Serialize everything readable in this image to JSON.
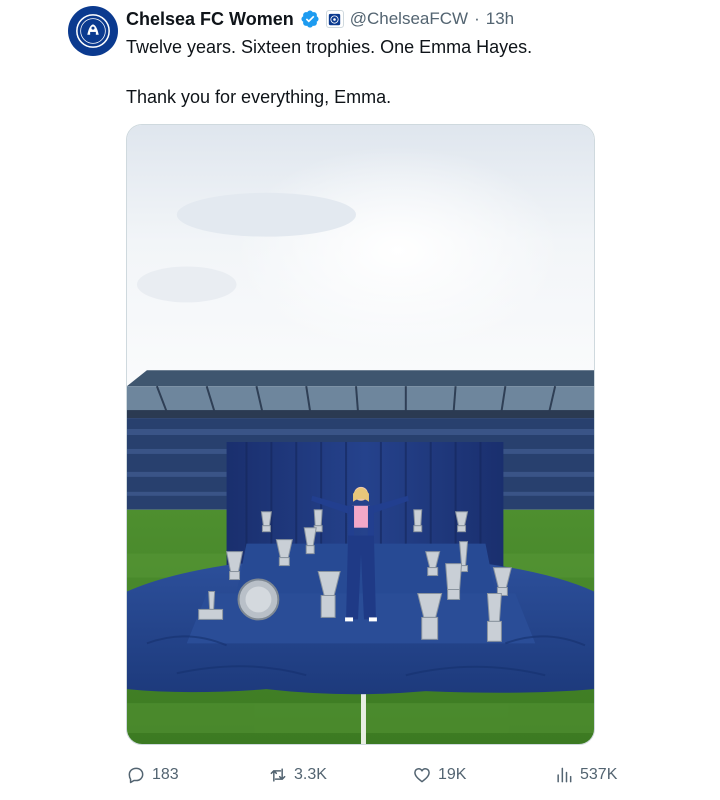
{
  "author": {
    "display_name": "Chelsea FC Women",
    "handle": "@ChelseaFCW",
    "separator": "·",
    "time": "13h",
    "avatar_icon": "chelsea-crest-icon",
    "verified_icon": "verified-badge-icon",
    "affiliation_icon": "chelsea-affiliate-badge-icon"
  },
  "tweet": {
    "line1": "Twelve years. Sixteen trophies. One Emma Hayes.",
    "line2": "Thank you for everything, Emma."
  },
  "media": {
    "description_icon": "photo-emma-hayes-trophies"
  },
  "actions": {
    "replies": "183",
    "reposts": "3.3K",
    "likes": "19K",
    "views": "537K"
  },
  "colors": {
    "text": "#0f1419",
    "secondary": "#536471",
    "verified": "#1d9bf0",
    "chelsea_blue": "#0b3a8f"
  }
}
